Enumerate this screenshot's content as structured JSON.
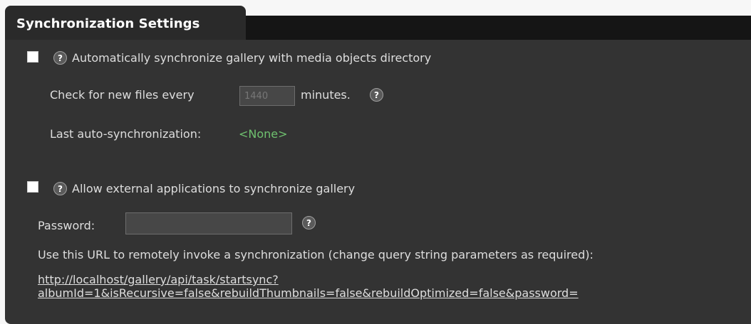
{
  "section": {
    "title": "Synchronization Settings"
  },
  "auto_sync": {
    "checkbox_label": "Automatically synchronize gallery with media objects directory",
    "interval_prefix": "Check for new files every",
    "interval_value": "1440",
    "interval_suffix": "minutes.",
    "last_sync_label": "Last auto-synchronization:",
    "last_sync_value": "<None>"
  },
  "external_sync": {
    "checkbox_label": "Allow external applications to synchronize gallery",
    "password_label": "Password:",
    "password_value": "",
    "url_instructions": "Use this URL to remotely invoke a synchronization (change query string parameters as required):",
    "url_line1": "http://localhost/gallery/api/task/startsync?",
    "url_line2": "albumId=1&isRecursive=false&rebuildThumbnails=false&rebuildOptimized=false&password="
  },
  "help_icon_glyph": "?",
  "colors": {
    "panel_background": "#333333",
    "tab_background": "#2a2a2a",
    "text": "#dedede",
    "status_value": "#6fc16f"
  }
}
